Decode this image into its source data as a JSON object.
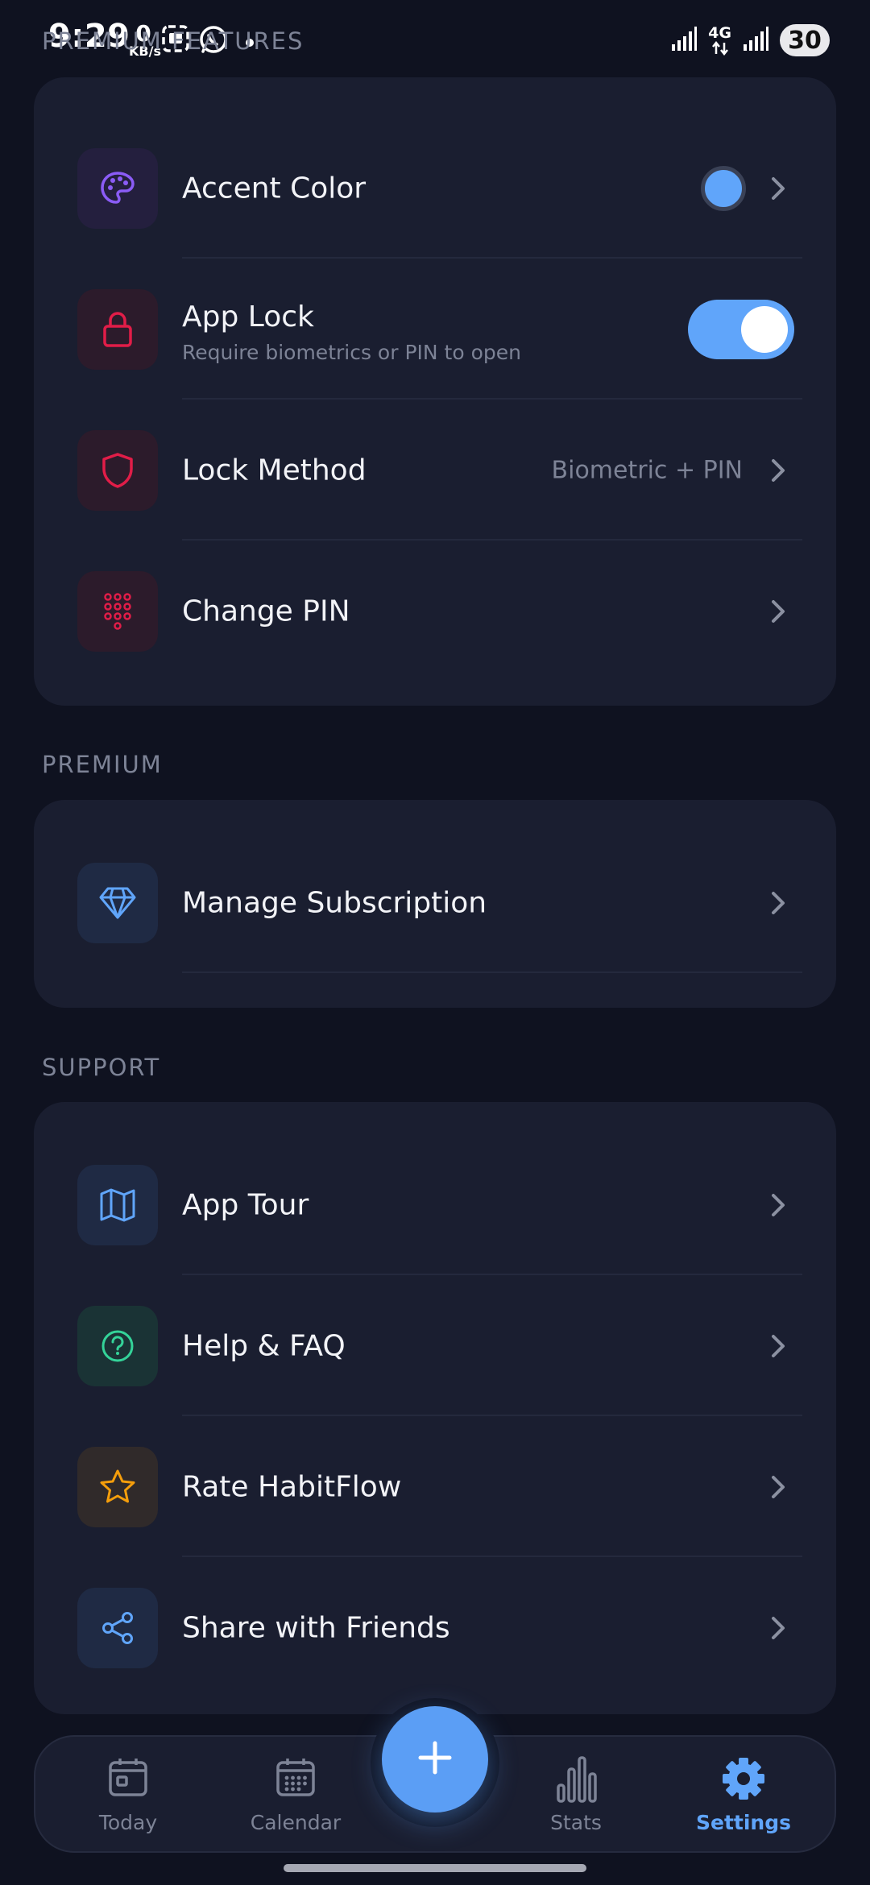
{
  "status_bar": {
    "time": "9:29",
    "net_speed_value": "0",
    "net_speed_unit": "KB/s",
    "network_type": "4G",
    "battery": "30"
  },
  "sections": {
    "features_label": "PREMIUM FEATURES",
    "premium_label": "PREMIUM",
    "support_label": "SUPPORT"
  },
  "features": {
    "accent_color": {
      "title": "Accent Color",
      "icon": "palette-icon",
      "swatch_color": "#60a5fa"
    },
    "app_lock": {
      "title": "App Lock",
      "subtitle": "Require biometrics or PIN to open",
      "icon": "lock-icon",
      "enabled": true
    },
    "lock_method": {
      "title": "Lock Method",
      "value": "Biometric + PIN",
      "icon": "shield-icon"
    },
    "change_pin": {
      "title": "Change PIN",
      "icon": "keypad-icon"
    }
  },
  "premium": {
    "manage_subscription": {
      "title": "Manage Subscription",
      "icon": "diamond-icon"
    }
  },
  "support": {
    "app_tour": {
      "title": "App Tour",
      "icon": "map-icon"
    },
    "help_faq": {
      "title": "Help & FAQ",
      "icon": "help-circle-icon"
    },
    "rate": {
      "title": "Rate HabitFlow",
      "icon": "star-icon"
    },
    "share": {
      "title": "Share with Friends",
      "icon": "share-icon"
    }
  },
  "nav": {
    "today": "Today",
    "calendar": "Calendar",
    "stats": "Stats",
    "settings": "Settings",
    "active": "settings"
  },
  "colors": {
    "background": "#0f1220",
    "card": "#1a1e30",
    "accent": "#60a5fa",
    "muted_text": "#7d8396",
    "danger_icon": "#e11d48",
    "purple_icon": "#8b5cf6",
    "green_icon": "#34d399",
    "gold_icon": "#f59e0b"
  }
}
